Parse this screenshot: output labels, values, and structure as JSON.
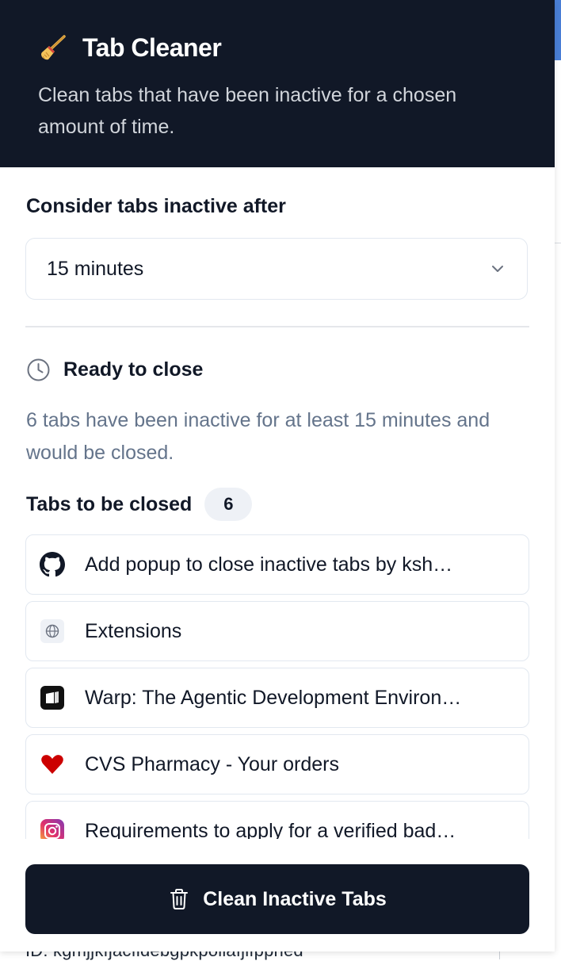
{
  "header": {
    "title": "Tab Cleaner",
    "subtitle": "Clean tabs that have been inactive for a chosen amount of time.",
    "icon": "broom-icon"
  },
  "settings": {
    "label": "Consider tabs inactive after",
    "selected_value": "15 minutes"
  },
  "status": {
    "title": "Ready to close",
    "description": "6 tabs have been inactive for at least 15 minutes and would be closed.",
    "icon": "clock-icon"
  },
  "tabs_section": {
    "label": "Tabs to be closed",
    "count": "6",
    "items": [
      {
        "title": "Add popup to close inactive tabs by ksh…",
        "favicon": "github-icon"
      },
      {
        "title": "Extensions",
        "favicon": "globe-icon"
      },
      {
        "title": "Warp: The Agentic Development Environ…",
        "favicon": "warp-icon"
      },
      {
        "title": "CVS Pharmacy - Your orders",
        "favicon": "cvs-heart-icon"
      },
      {
        "title": "Requirements to apply for a verified bad…",
        "favicon": "instagram-icon"
      }
    ]
  },
  "action": {
    "label": "Clean Inactive Tabs",
    "icon": "trash-icon"
  },
  "background": {
    "partial_text": "ID: kgmjjkfjacfidebgpkpollafjlfppned"
  },
  "colors": {
    "header_bg": "#111827",
    "button_bg": "#111827",
    "muted_text": "#64748b",
    "border": "#e2e8f0"
  }
}
